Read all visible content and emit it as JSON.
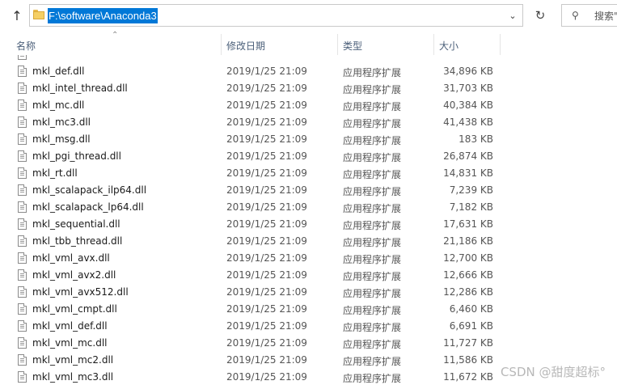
{
  "address": {
    "path": "F:\\software\\Anaconda3"
  },
  "search": {
    "placeholder": "搜索\""
  },
  "columns": {
    "name": "名称",
    "date": "修改日期",
    "type": "类型",
    "size": "大小"
  },
  "files": [
    {
      "name": "mkl_...",
      "date": "",
      "type": "",
      "size": "",
      "partial": true
    },
    {
      "name": "mkl_def.dll",
      "date": "2019/1/25 21:09",
      "type": "应用程序扩展",
      "size": "34,896 KB"
    },
    {
      "name": "mkl_intel_thread.dll",
      "date": "2019/1/25 21:09",
      "type": "应用程序扩展",
      "size": "31,703 KB"
    },
    {
      "name": "mkl_mc.dll",
      "date": "2019/1/25 21:09",
      "type": "应用程序扩展",
      "size": "40,384 KB"
    },
    {
      "name": "mkl_mc3.dll",
      "date": "2019/1/25 21:09",
      "type": "应用程序扩展",
      "size": "41,438 KB"
    },
    {
      "name": "mkl_msg.dll",
      "date": "2019/1/25 21:09",
      "type": "应用程序扩展",
      "size": "183 KB"
    },
    {
      "name": "mkl_pgi_thread.dll",
      "date": "2019/1/25 21:09",
      "type": "应用程序扩展",
      "size": "26,874 KB"
    },
    {
      "name": "mkl_rt.dll",
      "date": "2019/1/25 21:09",
      "type": "应用程序扩展",
      "size": "14,831 KB"
    },
    {
      "name": "mkl_scalapack_ilp64.dll",
      "date": "2019/1/25 21:09",
      "type": "应用程序扩展",
      "size": "7,239 KB"
    },
    {
      "name": "mkl_scalapack_lp64.dll",
      "date": "2019/1/25 21:09",
      "type": "应用程序扩展",
      "size": "7,182 KB"
    },
    {
      "name": "mkl_sequential.dll",
      "date": "2019/1/25 21:09",
      "type": "应用程序扩展",
      "size": "17,631 KB"
    },
    {
      "name": "mkl_tbb_thread.dll",
      "date": "2019/1/25 21:09",
      "type": "应用程序扩展",
      "size": "21,186 KB"
    },
    {
      "name": "mkl_vml_avx.dll",
      "date": "2019/1/25 21:09",
      "type": "应用程序扩展",
      "size": "12,700 KB"
    },
    {
      "name": "mkl_vml_avx2.dll",
      "date": "2019/1/25 21:09",
      "type": "应用程序扩展",
      "size": "12,666 KB"
    },
    {
      "name": "mkl_vml_avx512.dll",
      "date": "2019/1/25 21:09",
      "type": "应用程序扩展",
      "size": "12,286 KB"
    },
    {
      "name": "mkl_vml_cmpt.dll",
      "date": "2019/1/25 21:09",
      "type": "应用程序扩展",
      "size": "6,460 KB"
    },
    {
      "name": "mkl_vml_def.dll",
      "date": "2019/1/25 21:09",
      "type": "应用程序扩展",
      "size": "6,691 KB"
    },
    {
      "name": "mkl_vml_mc.dll",
      "date": "2019/1/25 21:09",
      "type": "应用程序扩展",
      "size": "11,727 KB"
    },
    {
      "name": "mkl_vml_mc2.dll",
      "date": "2019/1/25 21:09",
      "type": "应用程序扩展",
      "size": "11,586 KB"
    },
    {
      "name": "mkl_vml_mc3.dll",
      "date": "2019/1/25 21:09",
      "type": "应用程序扩展",
      "size": "11,672 KB"
    }
  ],
  "watermark": "CSDN @甜度超标°",
  "colors": {
    "selection": "#0078d7",
    "folder": "#f5cf65",
    "header_text": "#4c607a"
  },
  "icons": {
    "up": "arrow-up-icon",
    "folder": "folder-icon",
    "dropdown": "chevron-down-icon",
    "refresh": "refresh-icon",
    "search": "search-icon",
    "file": "dll-file-icon"
  }
}
